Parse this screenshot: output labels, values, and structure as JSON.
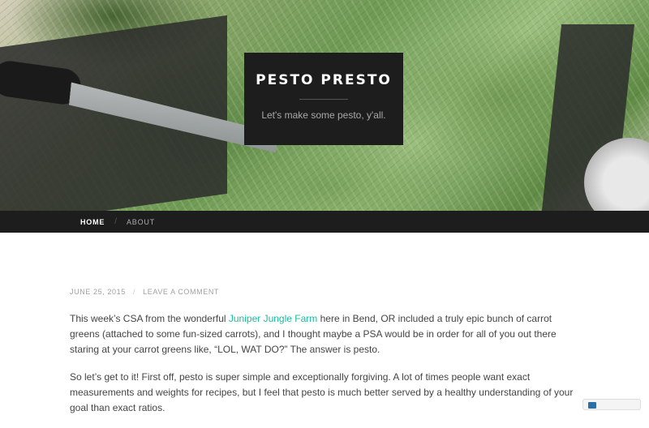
{
  "site": {
    "title": "PESTO PRESTO",
    "tagline": "Let's make some pesto, y'all."
  },
  "nav": {
    "items": [
      {
        "label": "HOME",
        "active": true
      },
      {
        "label": "ABOUT",
        "active": false
      }
    ],
    "separator": "/"
  },
  "post": {
    "date": "JUNE 25, 2015",
    "separator": "/",
    "comment_link": "LEAVE A COMMENT",
    "p1_before": "This week’s CSA from the wonderful ",
    "p1_link": "Juniper Jungle Farm",
    "p1_after": " here in Bend, OR included a truly epic bunch of carrot greens (attached to some fun-sized carrots), and I thought maybe a PSA would be in order for all of you out there staring at your carrot greens like, “LOL, WAT DO?” The answer is pesto.",
    "p2": "So let’s get to it! First off, pesto is super simple and exceptionally forgiving. A lot of times people want exact measurements and weights for recipes, but I feel that pesto is much better served by a healthy understanding of your goal than exact ratios."
  },
  "colors": {
    "link": "#1abc9c",
    "header_bg": "#1d1d1d"
  }
}
